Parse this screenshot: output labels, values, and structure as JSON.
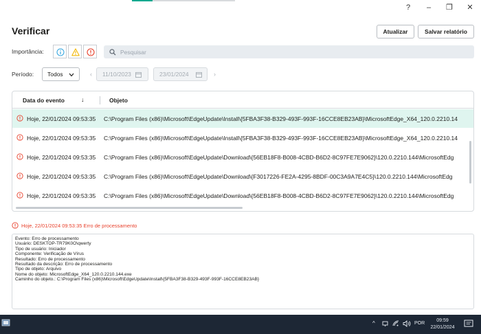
{
  "window": {
    "help": "?",
    "minimize": "–",
    "restore": "❐",
    "close": "✕"
  },
  "page": {
    "title": "Verificar",
    "update_button": "Atualizar",
    "save_report_button": "Salvar relatório"
  },
  "filters": {
    "importance_label": "Importância:",
    "importance_levels": [
      "info-icon",
      "warning-icon",
      "error-icon"
    ],
    "search_placeholder": "Pesquisar",
    "period_label": "Período:",
    "period_value": "Todos",
    "date_from": "11/10/2023",
    "date_to": "23/01/2024"
  },
  "table": {
    "columns": [
      "Data do evento",
      "Objeto"
    ],
    "sort_indicator": "↓",
    "rows": [
      {
        "date": "Hoje, 22/01/2024 09:53:35",
        "object": "C:\\Program Files (x86)\\Microsoft\\EdgeUpdate\\Install\\{5FBA3F38-B329-493F-993F-16CCE8EB23AB}\\MicrosoftEdge_X64_120.0.2210.14",
        "selected": true
      },
      {
        "date": "Hoje, 22/01/2024 09:53:35",
        "object": "C:\\Program Files (x86)\\Microsoft\\EdgeUpdate\\Install\\{5FBA3F38-B329-493F-993F-16CCE8EB23AB}\\MicrosoftEdge_X64_120.0.2210.14",
        "selected": false
      },
      {
        "date": "Hoje, 22/01/2024 09:53:35",
        "object": "C:\\Program Files (x86)\\Microsoft\\EdgeUpdate\\Download\\{56EB18F8-B008-4CBD-B6D2-8C97FE7E9062}\\120.0.2210.144\\MicrosoftEdg",
        "selected": false
      },
      {
        "date": "Hoje, 22/01/2024 09:53:35",
        "object": "C:\\Program Files (x86)\\Microsoft\\EdgeUpdate\\Download\\{F3017226-FE2A-4295-8BDF-00C3A9A7E4C5}\\120.0.2210.144\\MicrosoftEdg",
        "selected": false
      },
      {
        "date": "Hoje, 22/01/2024 09:53:35",
        "object": "C:\\Program Files (x86)\\Microsoft\\EdgeUpdate\\Download\\{56EB18F8-B008-4CBD-B6D2-8C97FE7E9062}\\120.0.2210.144\\MicrosoftEdg",
        "selected": false
      }
    ]
  },
  "details": {
    "header": "Hoje, 22/01/2024 09:53:35 Erro de processamento",
    "lines": [
      "Evento: Erro de processamento",
      "Usuário: DESKTOP-TR79K0O\\qwerty",
      "Tipo de usuário: Iniciador",
      "Componente: Verificação de Vírus",
      "Resultado: Erro de processamento",
      "Resultado da descrição: Erro de processamento",
      "Tipo de objeto: Arquivo",
      "Nome do objeto: MicrosoftEdge_X64_120.0.2210.144.exe",
      "Caminho do objeto.: C:\\Program Files (x86)\\Microsoft\\EdgeUpdate\\Install\\{5FBA3F38-B329-493F-993F-16CCE8EB23AB}"
    ]
  },
  "taskbar": {
    "language": "POR",
    "time": "09:59",
    "date": "22/01/2024",
    "tray_chevron": "^"
  },
  "colors": {
    "accent": "#00a88e",
    "error": "#e8412c",
    "warning": "#f2b705",
    "info": "#3aa8e0",
    "selected_row": "#dff5ef",
    "taskbar": "#1d2735"
  }
}
